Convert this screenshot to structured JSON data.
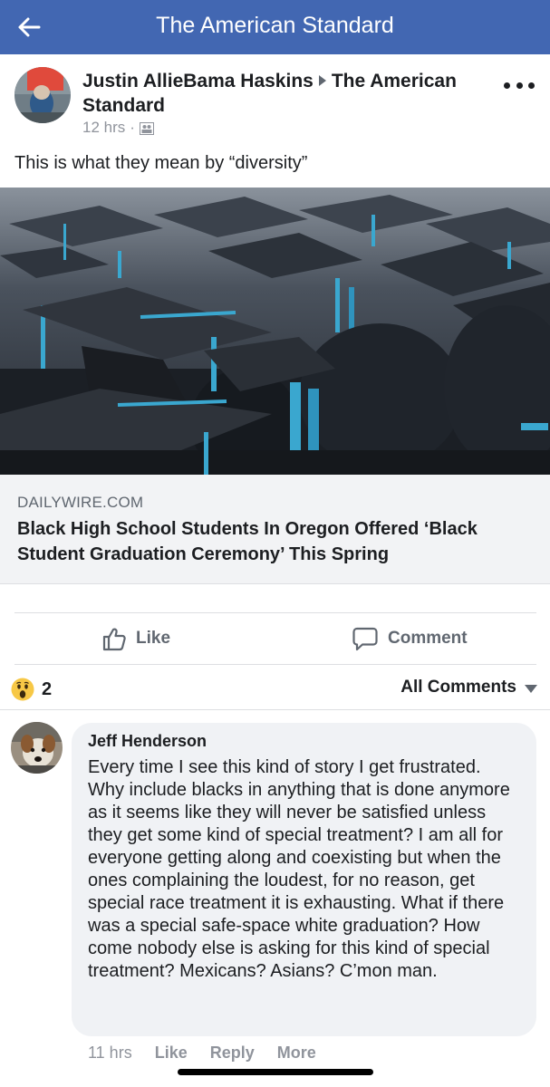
{
  "nav": {
    "back_icon": "back-arrow-icon",
    "title": "The American Standard"
  },
  "post": {
    "author": "Justin AllieBama Haskins",
    "target_page": "The American Standard",
    "time": "12 hrs",
    "separator": "·",
    "audience_icon": "group-audience-icon",
    "text": "This is what they mean by “diversity”"
  },
  "link": {
    "domain": "DAILYWIRE.COM",
    "title": "Black High School Students In Oregon Offered ‘Black Student Graduation Ceremony’ This Spring"
  },
  "actions": {
    "like_label": "Like",
    "comment_label": "Comment"
  },
  "reactions": {
    "icon": "wow-reaction-icon",
    "count": "2",
    "sort_label": "All Comments"
  },
  "comment": {
    "author": "Jeff Henderson",
    "text": "Every time I see this kind of story I get frustrated. Why include blacks in anything that is done anymore as it seems like they will never be satisfied unless they get some kind of special treatment? I am all for everyone getting along and coexisting but when the ones complaining the loudest, for no reason, get special race treatment it is exhausting. What if there was a special safe-space white graduation? How come nobody else is asking for this kind of special treatment? Mexicans? Asians? C’mon man.",
    "time": "11 hrs",
    "like_label": "Like",
    "reply_label": "Reply",
    "more_label": "More"
  },
  "colors": {
    "navbar": "#4267b2",
    "tassel": "#3aa7cf",
    "text": "#1c1e21",
    "muted": "#90949c"
  }
}
